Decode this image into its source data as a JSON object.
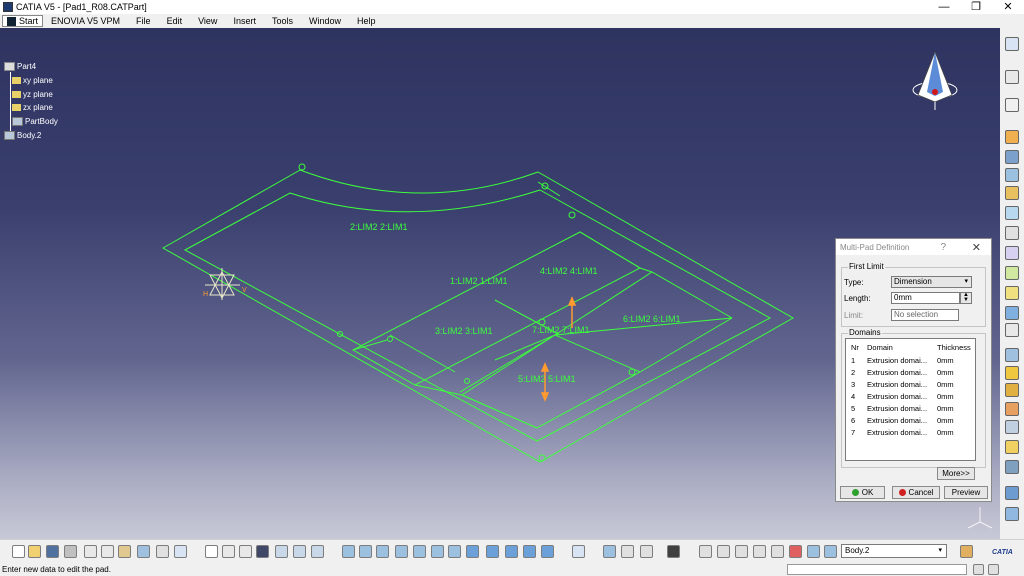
{
  "window": {
    "title": "CATIA V5 - [Pad1_R08.CATPart]",
    "minimize": "—",
    "restore": "❐",
    "close": "✕"
  },
  "menu": {
    "start": "Start",
    "items": [
      "ENOVIA V5 VPM",
      "File",
      "Edit",
      "View",
      "Insert",
      "Tools",
      "Window",
      "Help"
    ]
  },
  "tree": {
    "root": "Part4",
    "nodes": [
      "xy plane",
      "yz plane",
      "zx plane",
      "PartBody",
      "Body.2"
    ]
  },
  "viewport": {
    "domain_labels": [
      "2:LIM2 2:LIM1",
      "1:LIM2 1:LIM1",
      "4:LIM2 4:LIM1",
      "3:LIM2 3:LIM1",
      "7:LIM2 7:LIM1",
      "6:LIM2 6:LIM1",
      "5:LIM2 5:LIM1"
    ],
    "axis_labels": {
      "h": "H",
      "v": "V"
    },
    "line_color": "#3cff3c",
    "label_color": "#3cff3c",
    "background_top": "#2e3360",
    "background_bottom": "#c8c9d6"
  },
  "dialog": {
    "title": "Multi-Pad Definition",
    "help": "?",
    "close": "✕",
    "first_limit": {
      "label": "First Limit",
      "type_label": "Type:",
      "type_value": "Dimension",
      "length_label": "Length:",
      "length_value": "0mm",
      "limit_label": "Limit:",
      "limit_value": "No selection"
    },
    "domains": {
      "label": "Domains",
      "columns": [
        "Nr",
        "Domain",
        "Thickness"
      ],
      "rows": [
        {
          "nr": "1",
          "domain": "Extrusion domai...",
          "thickness": "0mm"
        },
        {
          "nr": "2",
          "domain": "Extrusion domai...",
          "thickness": "0mm"
        },
        {
          "nr": "3",
          "domain": "Extrusion domai...",
          "thickness": "0mm"
        },
        {
          "nr": "4",
          "domain": "Extrusion domai...",
          "thickness": "0mm"
        },
        {
          "nr": "5",
          "domain": "Extrusion domai...",
          "thickness": "0mm"
        },
        {
          "nr": "6",
          "domain": "Extrusion domai...",
          "thickness": "0mm"
        },
        {
          "nr": "7",
          "domain": "Extrusion domai...",
          "thickness": "0mm"
        }
      ]
    },
    "more_button": "More>>",
    "ok_button": "OK",
    "cancel_button": "Cancel",
    "preview_button": "Preview"
  },
  "toolbar": {
    "icons": [
      "new-icon",
      "open-icon",
      "save-icon",
      "print-icon",
      "cut-icon",
      "copy-icon",
      "paste-icon",
      "undo-icon",
      "redo-icon",
      "whats-this-icon",
      "formula-icon",
      "knowledge-icon",
      "measure-icon",
      "table-icon",
      "catalog-icon",
      "fly-icon",
      "fit-all-icon",
      "pan-icon",
      "rotate-icon",
      "zoom-in-icon",
      "zoom-out-icon",
      "normal-view-icon",
      "iso-view-icon",
      "views-icon",
      "hide-show-icon",
      "swap-icon",
      "shading-icon",
      "snap-icon",
      "3d-compass-icon",
      "tree-icon",
      "material-icon",
      "apply-icon"
    ],
    "body_select": "Body.2",
    "brand": "CATIA"
  },
  "status": {
    "message": "Enter new data to edit the pad."
  }
}
